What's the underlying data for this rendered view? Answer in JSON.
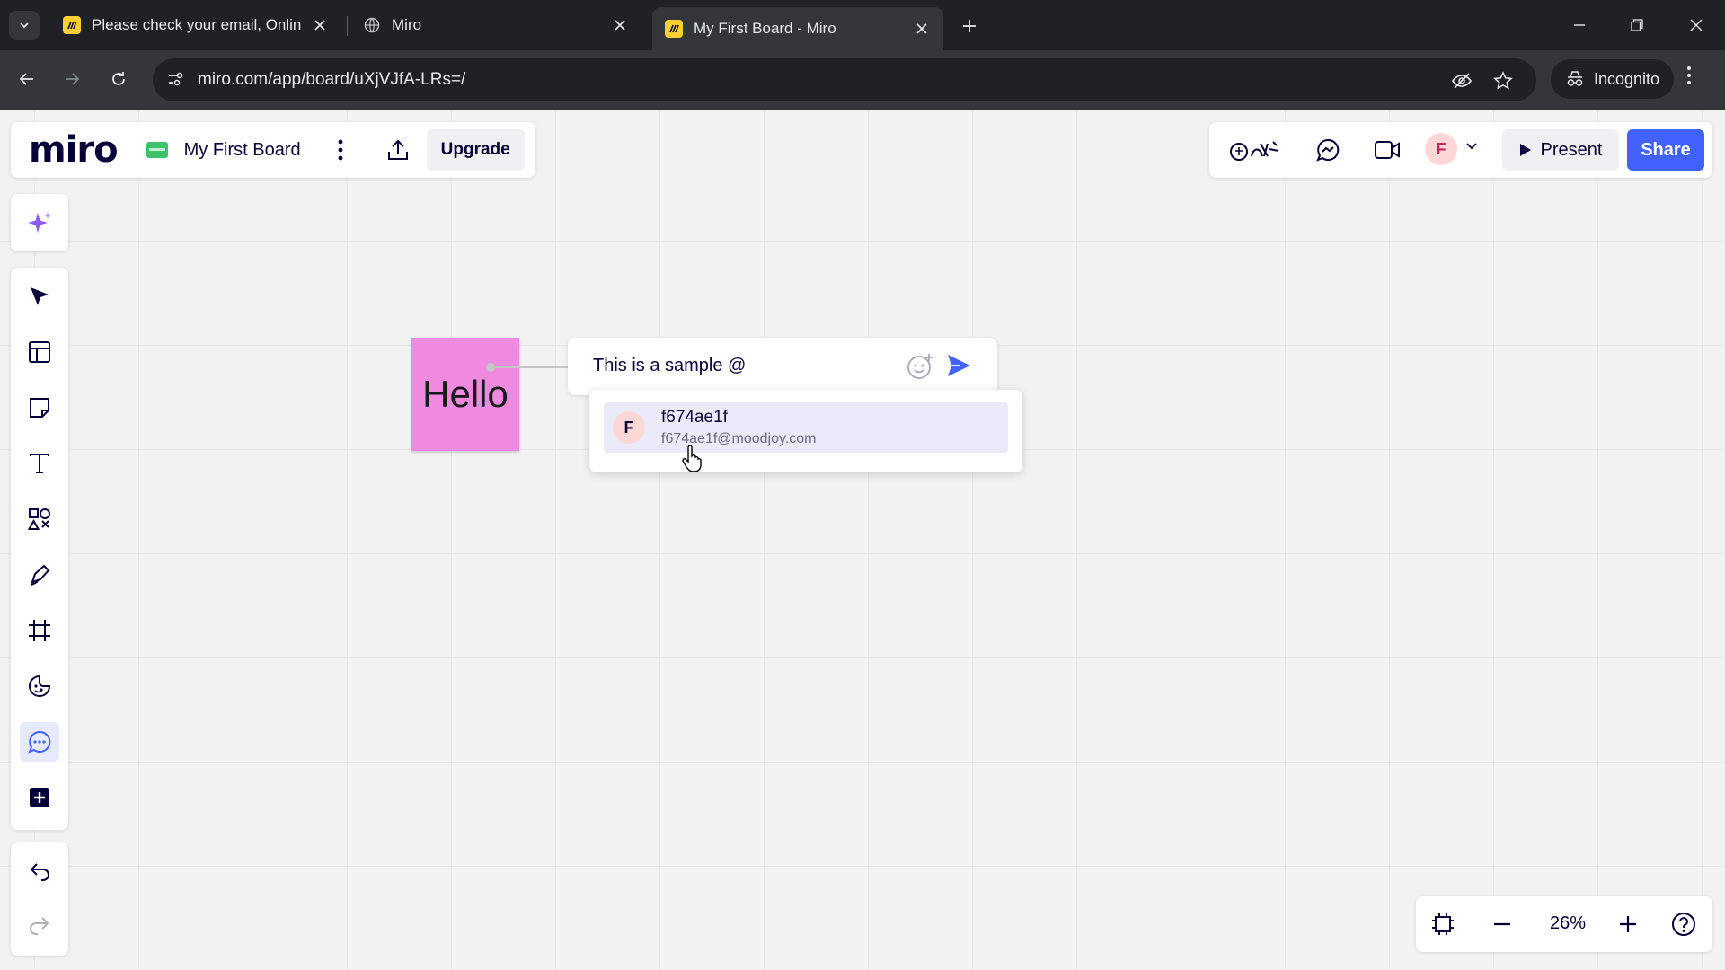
{
  "browser": {
    "tabs": [
      {
        "title": "Please check your email, Online",
        "active": false,
        "favicon": "miro-logo-icon"
      },
      {
        "title": "Miro",
        "active": false,
        "favicon": "globe-icon"
      },
      {
        "title": "My First Board - Miro",
        "active": true,
        "favicon": "miro-logo-icon"
      }
    ],
    "url": "miro.com/app/board/uXjVJfA-LRs=/",
    "profile_label": "Incognito"
  },
  "board": {
    "logo": "miro",
    "name": "My First Board",
    "upgrade_label": "Upgrade",
    "present_label": "Present",
    "share_label": "Share",
    "user_initial": "F",
    "sticky_text": "Hello",
    "comment": {
      "text": "This is a sample @"
    },
    "mention": {
      "initial": "F",
      "name": "f674ae1f",
      "email": "f674ae1f@moodjoy.com"
    },
    "zoom": "26%"
  },
  "colors": {
    "accent": "#4262ff",
    "sticky": "#f08ae0",
    "board_icon": "#3ec16b"
  }
}
